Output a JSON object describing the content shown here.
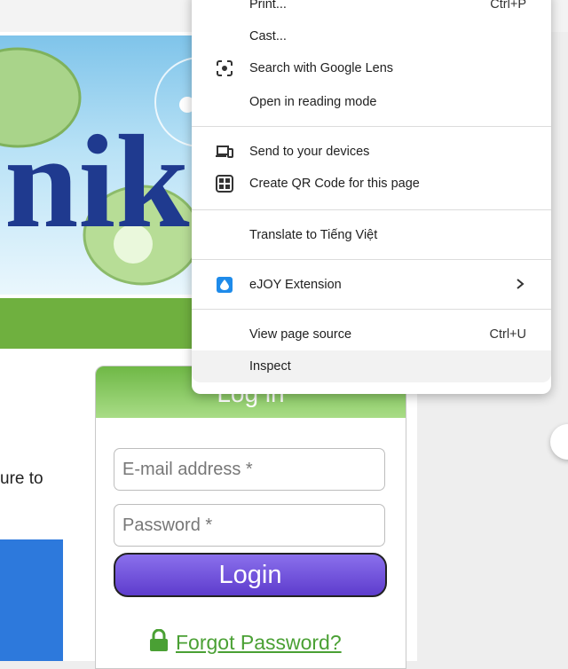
{
  "context_menu": {
    "items": [
      {
        "label": "Print...",
        "shortcut": "Ctrl+P",
        "icon": ""
      },
      {
        "label": "Cast...",
        "shortcut": "",
        "icon": ""
      },
      {
        "label": "Search with Google Lens",
        "shortcut": "",
        "icon": "google-lens-icon"
      },
      {
        "label": "Open in reading mode",
        "shortcut": "",
        "icon": ""
      },
      {
        "label": "Send to your devices",
        "shortcut": "",
        "icon": "devices-icon"
      },
      {
        "label": "Create QR Code for this page",
        "shortcut": "",
        "icon": "qr-code-icon"
      },
      {
        "label": "Translate to Tiếng Việt",
        "shortcut": "",
        "icon": ""
      },
      {
        "label": "eJOY Extension",
        "shortcut": "",
        "icon": "ejoy-icon"
      },
      {
        "label": "View page source",
        "shortcut": "Ctrl+U",
        "icon": ""
      },
      {
        "label": "Inspect",
        "shortcut": "",
        "icon": ""
      }
    ]
  },
  "page": {
    "side_text": "ure to",
    "login": {
      "title": "Log in",
      "email_placeholder": "E-mail address *",
      "password_placeholder": "Password *",
      "button": "Login",
      "forgot": "Forgot Password?"
    }
  },
  "colors": {
    "green_bar": "#6fb03f",
    "login_button": "#6a4bd8",
    "link": "#4aa034",
    "ejoy": "#1e8bea"
  }
}
